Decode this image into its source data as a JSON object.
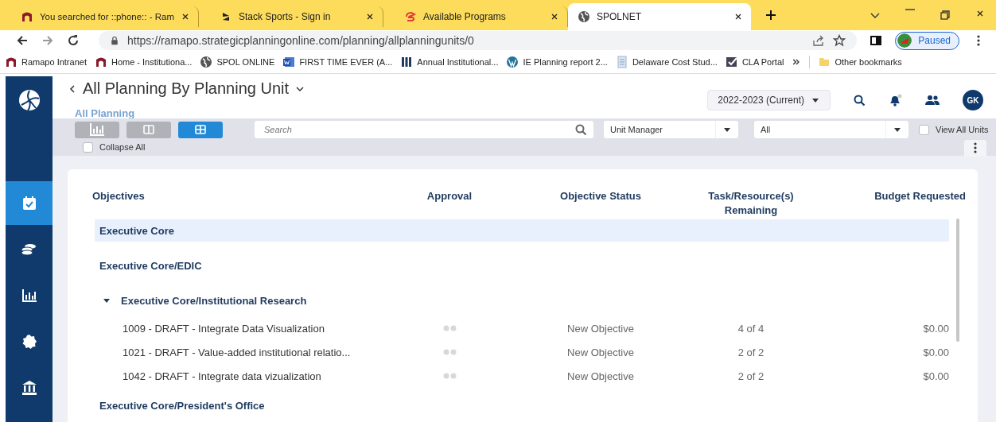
{
  "browser": {
    "tabs": [
      {
        "title": "You searched for ::phone:: - Ram",
        "selected": false
      },
      {
        "title": "Stack Sports - Sign in",
        "selected": false
      },
      {
        "title": "Available Programs",
        "selected": false
      },
      {
        "title": "SPOLNET",
        "selected": true
      }
    ],
    "url": "https://ramapo.strategicplanningonline.com/planning/allplanningunits/0",
    "profile_status": "Paused",
    "bookmarks": [
      {
        "label": "Ramapo Intranet"
      },
      {
        "label": "Home - Institutiona..."
      },
      {
        "label": "SPOL ONLINE"
      },
      {
        "label": "FIRST TIME EVER (A..."
      },
      {
        "label": "Annual Institutional..."
      },
      {
        "label": "IE Planning report 2..."
      },
      {
        "label": "Delaware Cost Stud..."
      },
      {
        "label": "CLA Portal"
      }
    ],
    "other_bookmarks": "Other bookmarks"
  },
  "sidebar": {
    "items": [
      {
        "selected": true
      },
      {
        "selected": false
      },
      {
        "selected": false
      },
      {
        "selected": false
      },
      {
        "selected": false
      }
    ]
  },
  "header": {
    "title": "All Planning By Planning Unit",
    "breadcrumb": "All Planning",
    "year": "2022-2023 (Current)",
    "avatar": "GK"
  },
  "toolbar": {
    "views": [
      {
        "selected": false
      },
      {
        "selected": false
      },
      {
        "selected": true
      }
    ],
    "search": {
      "placeholder": "Search"
    },
    "dropdowns": [
      {
        "value": "Unit Manager"
      },
      {
        "value": "All"
      }
    ],
    "view_all_units": {
      "label": "View All Units",
      "checked": false
    },
    "collapse_all": {
      "label": "Collapse All",
      "checked": false
    }
  },
  "table": {
    "columns": [
      "Objectives",
      "Approval",
      "Objective Status",
      "Task/Resource(s) Remaining",
      "Budget Requested"
    ],
    "groups": [
      {
        "name": "Executive Core",
        "selected": true
      },
      {
        "name": "Executive Core/EDIC",
        "selected": false
      },
      {
        "name": "Executive Core/Institutional Research",
        "selected": false,
        "expanded": true,
        "children": [
          {
            "objective": "1009 - DRAFT - Integrate Data Visualization",
            "status": "New Objective",
            "tasks": "4 of 4",
            "budget": "$0.00"
          },
          {
            "objective": "1021 - DRAFT - Value-added institutional relatio...",
            "status": "New Objective",
            "tasks": "2 of 2",
            "budget": "$0.00"
          },
          {
            "objective": "1042 - DRAFT - Integrate data vizualization",
            "status": "New Objective",
            "tasks": "2 of 2",
            "budget": "$0.00"
          }
        ]
      },
      {
        "name": "Executive Core/President's Office",
        "selected": false
      }
    ]
  }
}
